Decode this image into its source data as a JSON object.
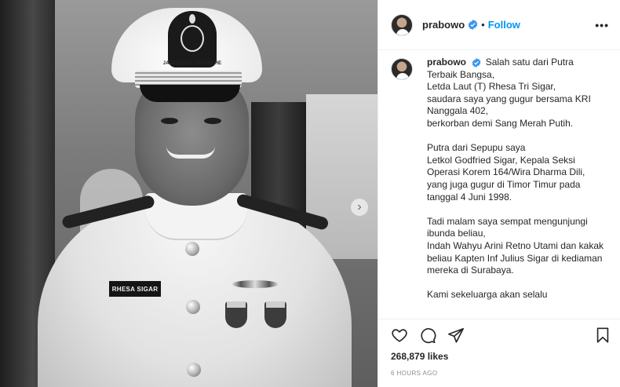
{
  "header": {
    "username": "prabowo",
    "separator": "•",
    "follow_label": "Follow",
    "more_label": "•••"
  },
  "photo": {
    "nameplate_text": "RHESA SIGAR",
    "cap_motto": "JALESVEVA JAYAMAHE",
    "next_label": "›"
  },
  "caption": {
    "username": "prabowo",
    "paragraphs": [
      [
        "Salah satu dari Putra Terbaik Bangsa,",
        "Letda Laut (T) Rhesa Tri Sigar,",
        "saudara saya yang gugur bersama KRI Nanggala 402,",
        "berkorban demi Sang Merah Putih."
      ],
      [
        "Putra dari Sepupu saya",
        "Letkol Godfried Sigar, Kepala Seksi Operasi Korem 164/Wira Dharma Dili,",
        "yang juga gugur di Timor Timur pada tanggal 4 Juni 1998."
      ],
      [
        "Tadi malam saya sempat mengunjungi ibunda beliau,",
        "Indah Wahyu Arini Retno Utami dan kakak beliau Kapten Inf Julius Sigar di kediaman mereka di Surabaya."
      ],
      [
        "Kami sekeluarga akan selalu"
      ]
    ]
  },
  "actions": {
    "icons": [
      "heart-icon",
      "comment-icon",
      "share-icon",
      "bookmark-icon"
    ]
  },
  "likes_text": "268,879 likes",
  "timestamp": "6 HOURS AGO",
  "colors": {
    "link": "#0095f6",
    "verified": "#3897f0",
    "text": "#262626",
    "muted": "#8e8e8e",
    "border": "#efefef"
  }
}
